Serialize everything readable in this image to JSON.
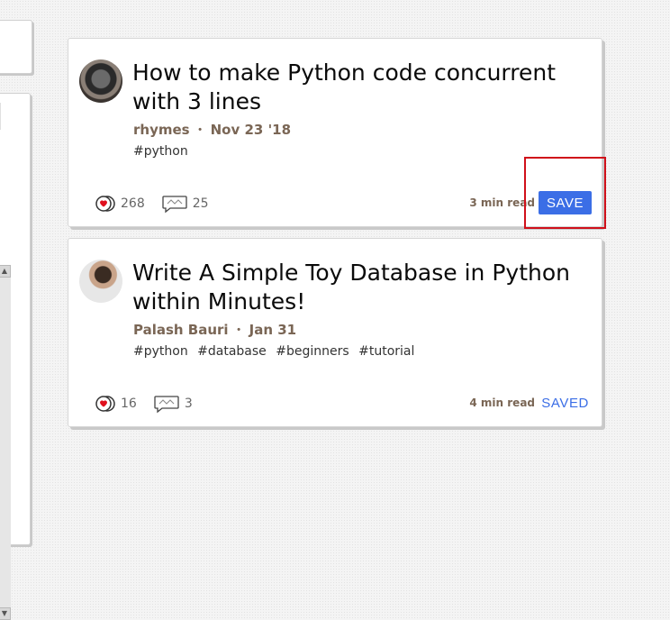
{
  "articles": [
    {
      "title": "How to make Python code concurrent with 3 lines",
      "author": "rhymes",
      "separator": "・",
      "date": "Nov 23 '18",
      "tags": [
        "#python"
      ],
      "reactions": "268",
      "comments": "25",
      "read_time": "3 min read",
      "action_label": "SAVE"
    },
    {
      "title": "Write A Simple Toy Database in Python within Minutes!",
      "author": "Palash Bauri",
      "separator": "・",
      "date": "Jan 31",
      "tags": [
        "#python",
        "#database",
        "#beginners",
        "#tutorial"
      ],
      "reactions": "16",
      "comments": "3",
      "read_time": "4 min read",
      "action_label": "SAVED"
    }
  ],
  "scrollbar": {
    "up_glyph": "▲",
    "down_glyph": "▼"
  },
  "colors": {
    "accent": "#3b6ee6",
    "highlight": "#d0101a",
    "meta": "#7a6655"
  }
}
